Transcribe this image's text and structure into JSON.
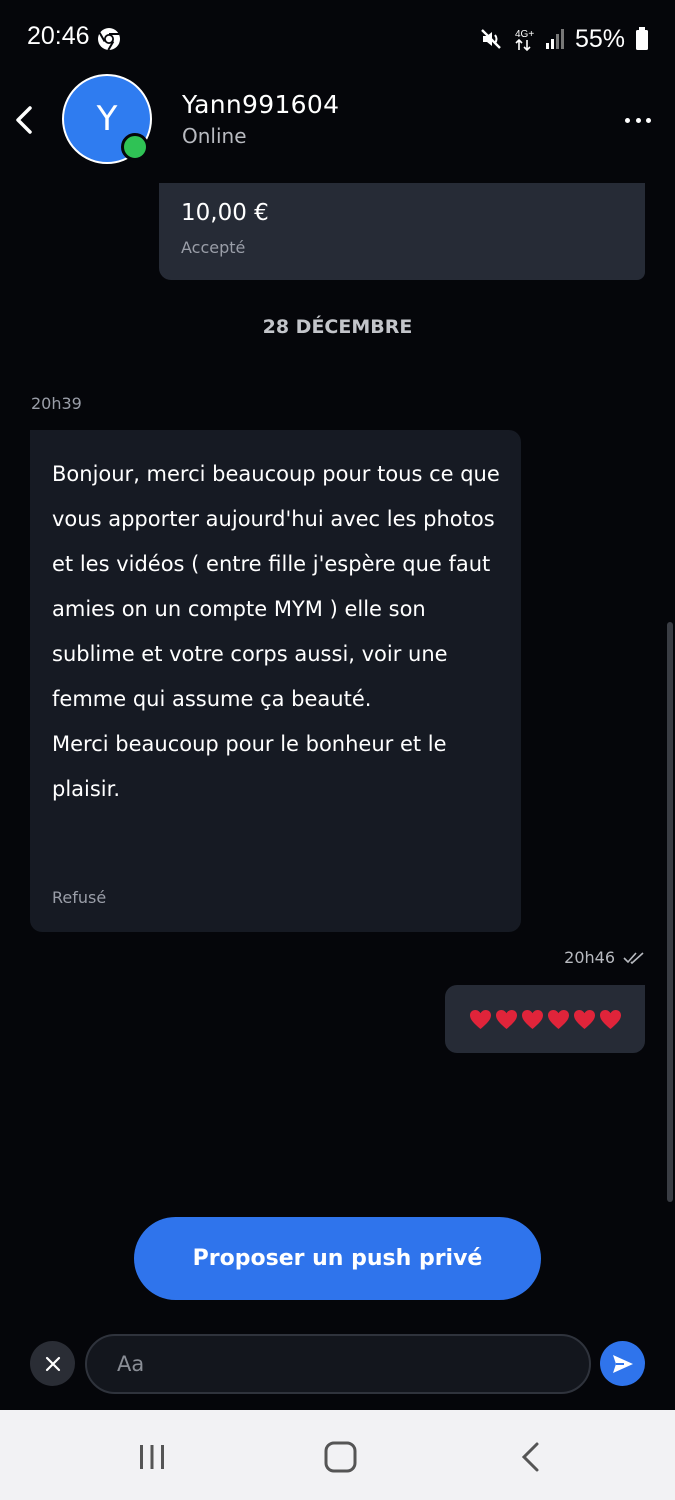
{
  "status_bar": {
    "time": "20:46",
    "network": "4G+",
    "battery": "55%"
  },
  "header": {
    "avatar_initial": "Y",
    "user_name": "Yann991604",
    "user_status": "Online"
  },
  "conversation": {
    "payment": {
      "amount": "10,00 €",
      "status": "Accepté"
    },
    "date_divider": "28 DÉCEMBRE",
    "incoming": {
      "time": "20h39",
      "text": "Bonjour, merci beaucoup pour tous ce que vous apporter aujourd'hui avec les photos et les vidéos ( entre fille j'espère que faut amies on un compte MYM ) elle son sublime et votre corps aussi, voir une femme qui assume ça beauté.\nMerci beaucoup pour le bonheur et le plaisir.",
      "status": "Refusé"
    },
    "outgoing": {
      "time": "20h46",
      "content": "❤️❤️❤️❤️❤️❤️",
      "heart_count": 6
    }
  },
  "actions": {
    "push_button_label": "Proposer un push privé"
  },
  "composer": {
    "placeholder": "Aa",
    "value": ""
  },
  "colors": {
    "background": "#05060a",
    "accent": "#2f74ec",
    "online": "#2fc255",
    "heart": "#e0243a",
    "bubble": "#262b36"
  },
  "icons": [
    "chrome-icon",
    "mute-icon",
    "signal-icon",
    "battery-icon",
    "back-arrow-icon",
    "more-icon",
    "double-check-icon",
    "heart-icon",
    "close-icon",
    "send-icon",
    "recents-icon",
    "home-icon",
    "nav-back-icon"
  ]
}
